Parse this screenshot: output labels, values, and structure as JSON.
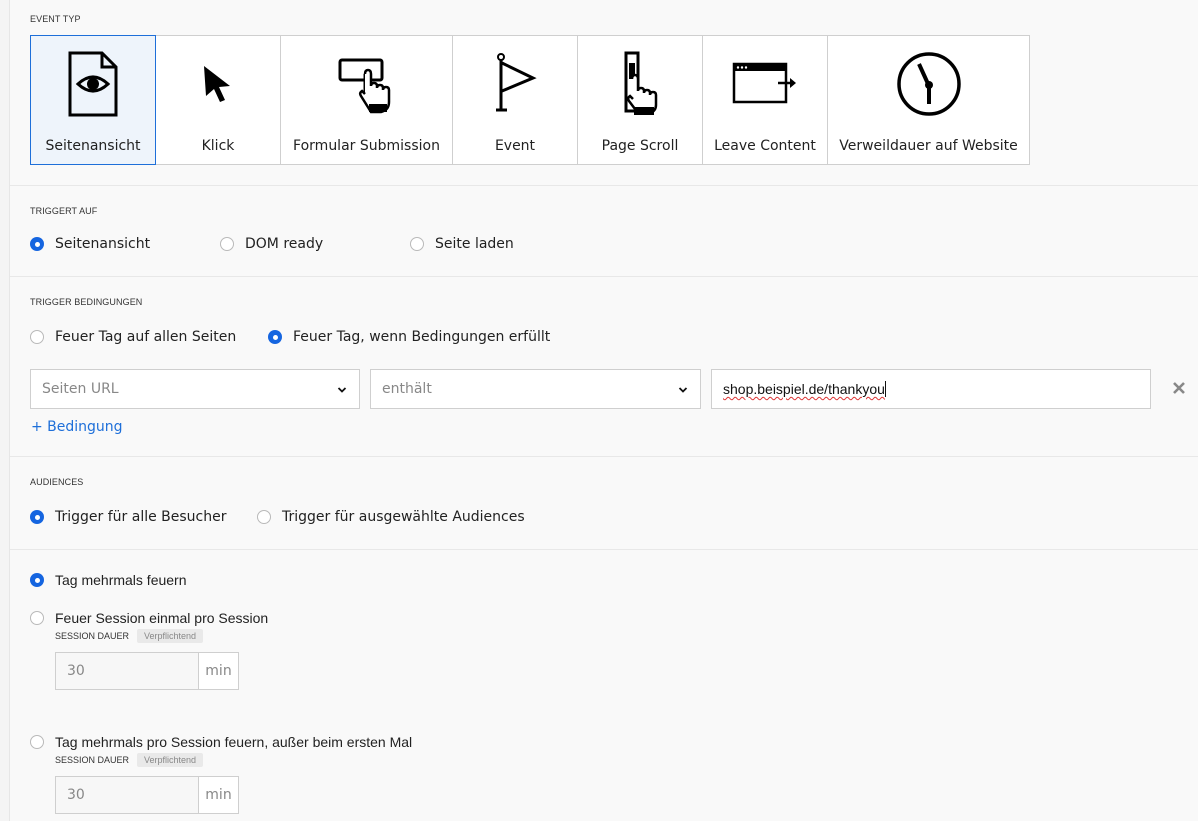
{
  "event_type": {
    "label": "EVENT TYP",
    "tiles": [
      {
        "label": "Seitenansicht",
        "icon": "document-eye-icon",
        "selected": true
      },
      {
        "label": "Klick",
        "icon": "cursor-arrow-icon",
        "selected": false
      },
      {
        "label": "Formular Submission",
        "icon": "form-submit-hand-icon",
        "selected": false
      },
      {
        "label": "Event",
        "icon": "flag-icon",
        "selected": false
      },
      {
        "label": "Page Scroll",
        "icon": "scroll-hand-icon",
        "selected": false
      },
      {
        "label": "Leave Content",
        "icon": "window-exit-icon",
        "selected": false
      },
      {
        "label": "Verweildauer auf Website",
        "icon": "clock-icon",
        "selected": false
      }
    ]
  },
  "triggert_auf": {
    "label": "TRIGGERT AUF",
    "options": [
      {
        "label": "Seitenansicht",
        "checked": true
      },
      {
        "label": "DOM ready",
        "checked": false
      },
      {
        "label": "Seite laden",
        "checked": false
      }
    ]
  },
  "trigger_bedingungen": {
    "label": "TRIGGER BEDINGUNGEN",
    "options": [
      {
        "label": "Feuer Tag auf allen Seiten",
        "checked": false
      },
      {
        "label": "Feuer Tag, wenn Bedingungen erfüllt",
        "checked": true
      }
    ],
    "condition": {
      "field": "Seiten URL",
      "operator": "enthält",
      "value": "shop.beispiel.de/thankyou"
    },
    "add_condition": "+ Bedingung"
  },
  "audiences": {
    "label": "AUDIENCES",
    "options": [
      {
        "label": "Trigger für alle Besucher",
        "checked": true
      },
      {
        "label": "Trigger für ausgewählte Audiences",
        "checked": false
      }
    ]
  },
  "frequency": {
    "options": [
      {
        "label": "Tag mehrmals feuern",
        "checked": true
      },
      {
        "label": "Feuer Session einmal pro Session",
        "checked": false,
        "sub_label": "SESSION DAUER",
        "badge": "Verpflichtend",
        "value": "30",
        "unit": "min"
      },
      {
        "label": "Tag mehrmals pro Session feuern, außer beim ersten Mal",
        "checked": false,
        "sub_label": "SESSION DAUER",
        "badge": "Verpflichtend",
        "value": "30",
        "unit": "min"
      }
    ]
  },
  "colors": {
    "accent": "#1565e0",
    "link": "#1e6fd9",
    "border": "#cfcfcf"
  }
}
